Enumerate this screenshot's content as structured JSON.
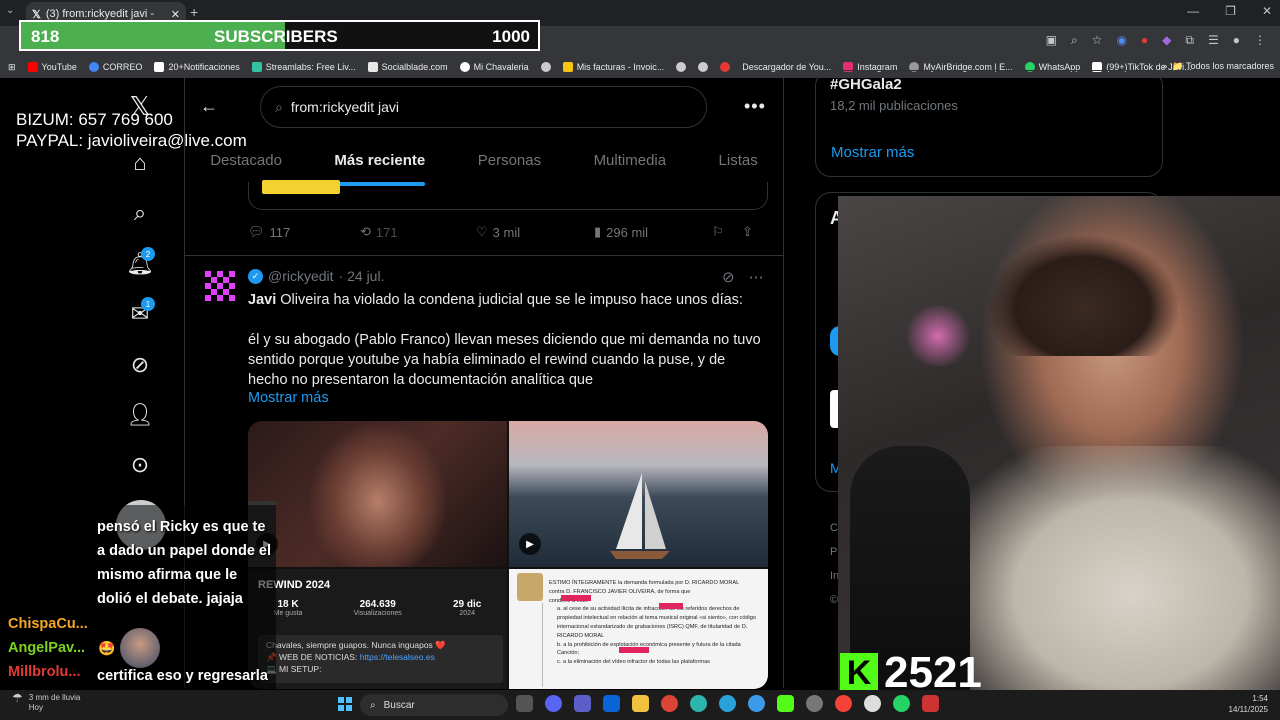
{
  "browser": {
    "tab_title": "(3) from:rickyedit javi - Buscar /",
    "new_tab": "+",
    "window_controls": [
      "—",
      "❐",
      "✕"
    ],
    "bookmarks": [
      {
        "label": "YouTube",
        "color": "#ff0000"
      },
      {
        "label": "CORREO",
        "color": "#4285f4"
      },
      {
        "label": "20+Notificaciones",
        "color": "#ffffff"
      },
      {
        "label": "Streamlabs: Free Liv...",
        "color": "#31c3a2"
      },
      {
        "label": "Socialblade.com",
        "color": "#e8e8e8"
      },
      {
        "label": "Mi Chavaleria",
        "color": "#ffffff"
      },
      {
        "label": "",
        "color": "#cccccc"
      },
      {
        "label": "Mis facturas - Invoic...",
        "color": "#f9c513"
      },
      {
        "label": "",
        "color": "#cccccc"
      },
      {
        "label": "",
        "color": "#cccccc"
      },
      {
        "label": "",
        "color": "#e53935"
      },
      {
        "label": "Descargador de You...",
        "color": "#cccccc"
      },
      {
        "label": "Instagram",
        "color": "#e1306c"
      },
      {
        "label": "MyAirBridge.com | E...",
        "color": "#999999"
      },
      {
        "label": "WhatsApp",
        "color": "#25d366"
      },
      {
        "label": "(99+)TikTok de Javi...",
        "color": "#ffffff"
      }
    ],
    "all_bookmarks": "Todos los marcadores"
  },
  "overlay": {
    "subs_current": "818",
    "subs_label": "SUBSCRIBERS",
    "subs_goal": "1000",
    "subs_fraction": 0.818,
    "bizum": "BIZUM: 657 769 600",
    "paypal": "PAYPAL: javioliveira@live.com",
    "kick_count": "2521",
    "chat_message": "pensó el Ricky es que te a dado un papel donde el mismo afirma que le dolió el debate. jajaja",
    "chat_message2": "certifica eso y regresarla :v",
    "chat_names": [
      {
        "name": "ChispaCu...",
        "color": "#f5a623"
      },
      {
        "name": "AngelPav...",
        "color": "#7ed321"
      },
      {
        "name": "Millbrolu...",
        "color": "#e53935"
      }
    ]
  },
  "twitter": {
    "nav_badges": {
      "notifications": "2",
      "messages": "1"
    },
    "search_query": "from:rickyedit javi",
    "tabs": [
      "Destacado",
      "Más reciente",
      "Personas",
      "Multimedia",
      "Listas"
    ],
    "active_tab": "Más reciente",
    "prev_tweet_stats": {
      "replies": "117",
      "reposts": "171",
      "likes": "3 mil",
      "views": "296 mil"
    },
    "tweet": {
      "handle": "@rickyedit",
      "date": "· 24 jul.",
      "text_line1_bold": "Javi",
      "text_line1": " Oliveira ha violado la condena judicial que se le impuso hace unos días:",
      "text_para2": "él y su abogado (Pablo Franco) llevan meses diciendo que mi demanda no tuvo sentido porque youtube ya había eliminado el rewind cuando la puse, y de hecho no presentaron la documentación analítica que",
      "show_more": "Mostrar más",
      "media_rewind": {
        "title": "REWIND 2024",
        "stats": [
          {
            "value": "18 K",
            "label": "Me gusta"
          },
          {
            "value": "264.639",
            "label": "Visualizaciones"
          },
          {
            "value": "29 dic",
            "label": "2024"
          }
        ],
        "desc1": "Chavales, siempre guapos. Nunca inguapos ❤️",
        "desc2": "📌 WEB DE NOTICIAS: ",
        "desc2_link": "https://telesalseo.es",
        "desc3": "💻 MI SETUP:"
      },
      "media_doc": {
        "line1": "ESTIMO ÍNTEGRAMENTE la demanda formulada por D. RICARDO MORAL",
        "line2": "contra D. FRANCISCO JAVIER OLIVEIRA, de forma que",
        "line3": "condeno a éste:",
        "line4": "a. al cese de su actividad ilícita de infracción de los referidos derechos de propiedad intelectual en relación al tema musical original «si siento», con código internacional estandarizado de grabaciones (ISRC) QMF, de titularidad de D. RICARDO MORAL",
        "line5": "b. a la prohibición de explotación económica presente y futura de la citada Canción;",
        "line6": "c. a la eliminación del vídeo infractor de todas las plataformas"
      }
    },
    "right": {
      "trend_tag": "#GHGala2",
      "trend_count": "18,2 mil publicaciones",
      "show_more": "Mostrar más"
    }
  },
  "taskbar": {
    "weather_line1": "3 mm de lluvia",
    "weather_line2": "Hoy",
    "search": "Buscar",
    "time": "1:54",
    "date": "14/11/2025"
  }
}
